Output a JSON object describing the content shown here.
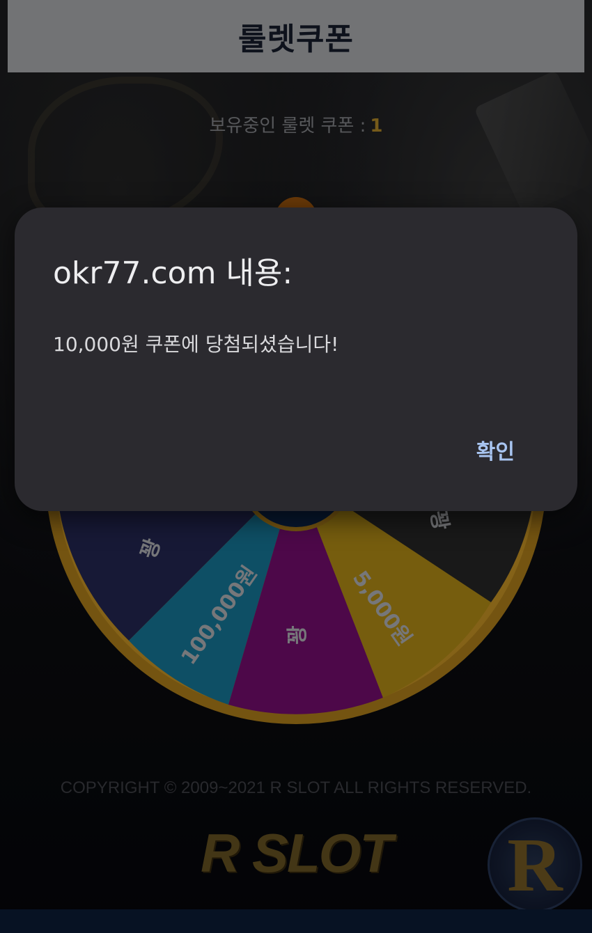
{
  "header": {
    "title": "룰렛쿠폰"
  },
  "coupon": {
    "label": "보유중인 룰렛 쿠폰 :",
    "count": "1"
  },
  "wheel": {
    "segments": [
      {
        "label": "꽝",
        "color": "#2b2e63"
      },
      {
        "label": "100,000원",
        "color": "#1a91b8"
      },
      {
        "label": "꽝",
        "color": "#8c0f86"
      },
      {
        "label": "5,000원",
        "color": "#d7a91a"
      },
      {
        "label": "꽝",
        "color": "#2e2e2e"
      }
    ],
    "rim_color": "#e0a52a"
  },
  "footer": {
    "copyright": "COPYRIGHT © 2009~2021 R SLOT ALL RIGHTS RESERVED.",
    "logo": "R SLOT",
    "badge": "R"
  },
  "dialog": {
    "title": "okr77.com 내용:",
    "message": "10,000원 쿠폰에 당첨되셨습니다!",
    "ok_label": "확인"
  }
}
